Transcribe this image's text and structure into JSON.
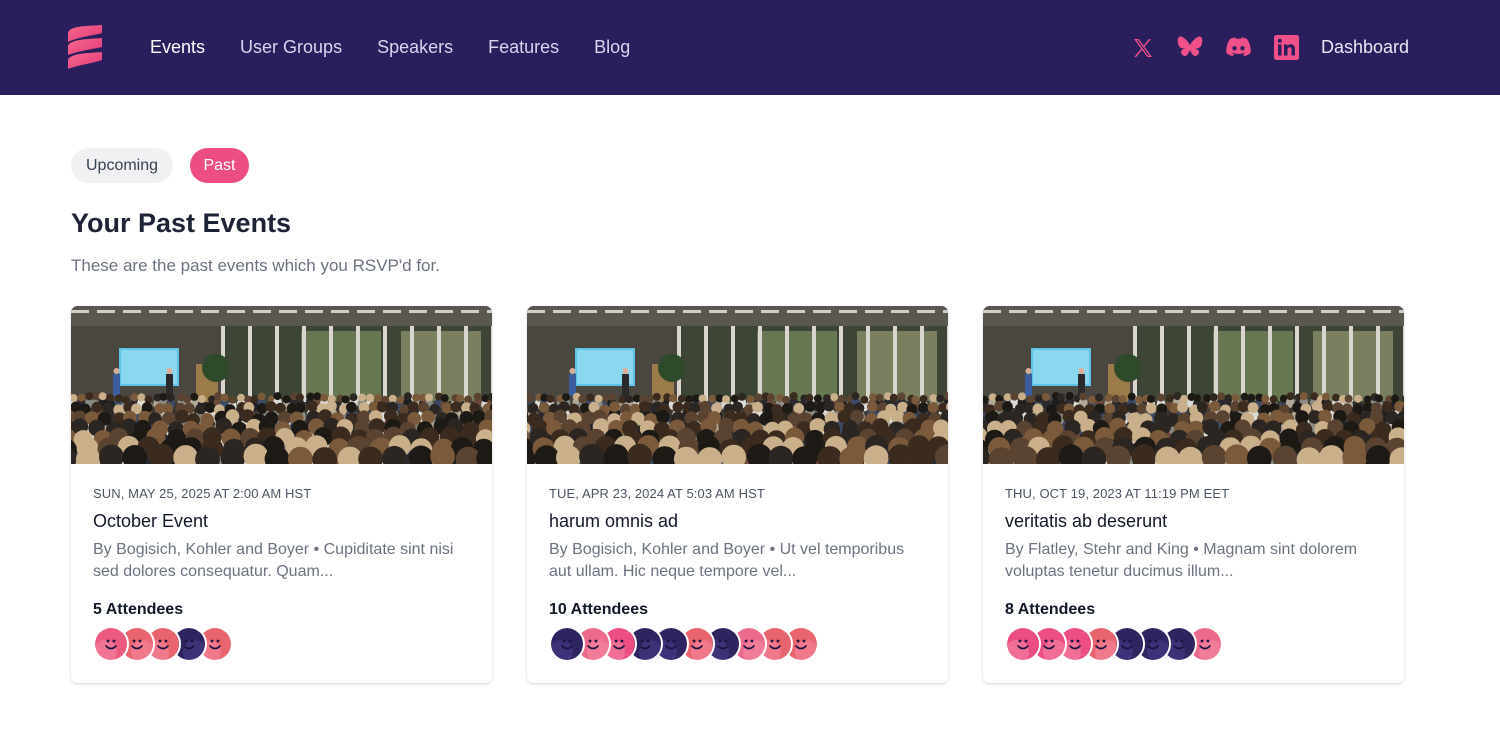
{
  "header": {
    "nav": [
      {
        "label": "Events",
        "active": true
      },
      {
        "label": "User Groups",
        "active": false
      },
      {
        "label": "Speakers",
        "active": false
      },
      {
        "label": "Features",
        "active": false
      },
      {
        "label": "Blog",
        "active": false
      }
    ],
    "social_icons": [
      "x-icon",
      "bluesky-icon",
      "discord-icon",
      "linkedin-icon"
    ],
    "dashboard_label": "Dashboard"
  },
  "filters": {
    "upcoming_label": "Upcoming",
    "past_label": "Past",
    "selected": "Past"
  },
  "page": {
    "title": "Your Past Events",
    "subtitle": "These are the past events which you RSVP'd for."
  },
  "events": [
    {
      "date": "SUN, MAY 25, 2025 AT 2:00 AM HST",
      "title": "October Event",
      "description": "By Bogisich, Kohler and Boyer • Cupiditate sint nisi sed dolores consequatur. Quam...",
      "attendees_label": "5 Attendees",
      "avatar_colors": [
        "#ec5a7f",
        "#e8646e",
        "#e8646e",
        "#2e2460",
        "#e8646e"
      ]
    },
    {
      "date": "TUE, APR 23, 2024 AT 5:03 AM HST",
      "title": "harum omnis ad",
      "description": "By Bogisich, Kohler and Boyer • Ut vel temporibus aut ullam. Hic neque tempore vel...",
      "attendees_label": "10 Attendees",
      "avatar_colors": [
        "#2e2460",
        "#ec6a8c",
        "#ec4e83",
        "#2e2460",
        "#2e2460",
        "#e8646e",
        "#2e2460",
        "#ec6a8c",
        "#e8646e",
        "#e8646e"
      ]
    },
    {
      "date": "THU, OCT 19, 2023 AT 11:19 PM EET",
      "title": "veritatis ab deserunt",
      "description": "By Flatley, Stehr and King • Magnam sint dolorem voluptas tenetur ducimus illum...",
      "attendees_label": "8 Attendees",
      "avatar_colors": [
        "#ec4e83",
        "#ec4e83",
        "#ec4e83",
        "#e8646e",
        "#2e2460",
        "#2e2460",
        "#2e2460",
        "#ec6a8c"
      ]
    }
  ],
  "colors": {
    "header_bg": "#2a1f5c",
    "accent": "#ec4e83",
    "icon_pink": "#f0508a"
  }
}
